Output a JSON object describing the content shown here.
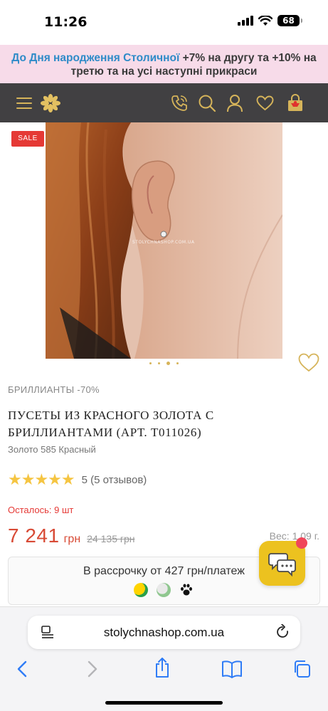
{
  "status_bar": {
    "time": "11:26",
    "battery": "68"
  },
  "promo": {
    "link_text": "До Дня народження Столичної",
    "rest_text": "+7% на другу та +10% на третю та на усі наступні прикраси"
  },
  "header": {
    "icons": [
      "menu-icon",
      "logo-icon",
      "phone-icon",
      "search-icon",
      "user-icon",
      "heart-icon",
      "cart-icon"
    ]
  },
  "product": {
    "badge": "SALE",
    "watermark": "STOLYCHNASHOP.COM.UA",
    "category": "БРИЛЛИАНТЫ -70%",
    "title": "ПУСЕТЫ ИЗ КРАСНОГО ЗОЛОТА С БРИЛЛИАНТАМИ (АРТ. Т011026)",
    "subtitle": "Золото 585 Красный",
    "rating_stars": "★★★★★",
    "rating_value": 5,
    "rating_text": "5 (5 отзывов)",
    "stock": "Осталось: 9 шт",
    "price": "7 241",
    "currency": "грн",
    "old_price": "24 135 грн",
    "weight": "Вес: 1,09 г."
  },
  "installment": {
    "text": "В рассрочку от 427 грн/платеж"
  },
  "browser": {
    "url": "stolychnashop.com.ua"
  },
  "colors": {
    "accent_gold": "#d6b45a",
    "header_bg": "#414042",
    "promo_bg": "#f7dbe9",
    "price_red": "#d84a35",
    "sale_red": "#e53935",
    "chat_yellow": "#ecc21f"
  }
}
